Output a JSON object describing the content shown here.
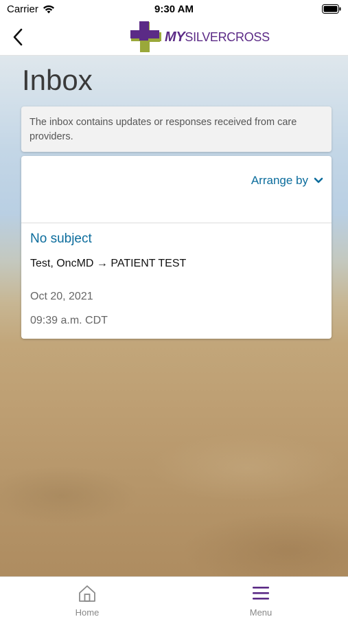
{
  "status_bar": {
    "carrier": "Carrier",
    "time": "9:30 AM"
  },
  "header": {
    "logo_my": "MY",
    "logo_name": "SILVERCROSS"
  },
  "page": {
    "title": "Inbox",
    "info": "The inbox contains updates or responses received from care providers."
  },
  "inbox": {
    "arrange_label": "Arrange by",
    "messages": [
      {
        "subject": "No subject",
        "route": "Test, OncMD → PATIENT TEST",
        "date": "Oct 20, 2021",
        "time": "09:39 a.m. CDT"
      }
    ]
  },
  "tabs": {
    "home": "Home",
    "menu": "Menu"
  },
  "colors": {
    "link": "#0b6c9c",
    "brand_purple": "#5b2a86",
    "brand_green": "#9aa83a"
  }
}
